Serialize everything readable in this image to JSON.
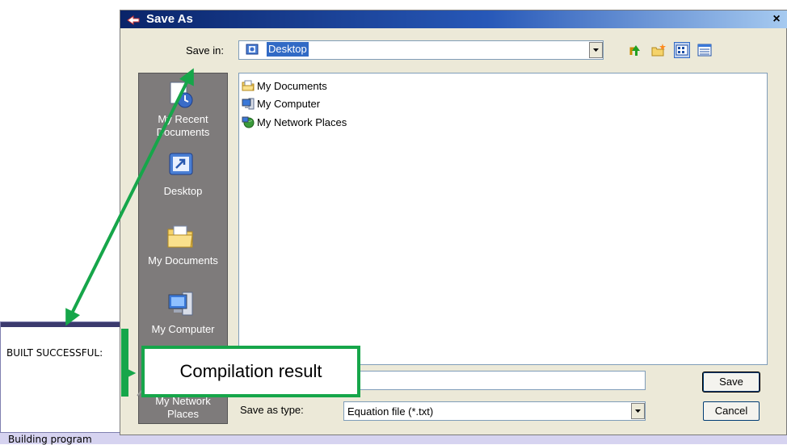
{
  "background_app": {
    "build_message": "BUILT SUCCESSFUL:",
    "status_text": "Building program"
  },
  "dialog": {
    "title": "Save As",
    "close_symbol": "×",
    "save_in_label": "Save in:",
    "save_in_value": "Desktop",
    "toolbar_icons": [
      "up-one-level-icon",
      "create-new-folder-icon",
      "view-menu-icon",
      "details-view-icon"
    ],
    "places": [
      {
        "label": "My Recent Documents",
        "icon": "recent-documents-icon"
      },
      {
        "label": "Desktop",
        "icon": "desktop-icon"
      },
      {
        "label": "My Documents",
        "icon": "my-documents-icon"
      },
      {
        "label": "My Computer",
        "icon": "my-computer-icon"
      },
      {
        "label": "My Network Places",
        "icon": "network-places-icon"
      }
    ],
    "files": [
      {
        "name": "My Documents",
        "icon": "folder-icon"
      },
      {
        "name": "My Computer",
        "icon": "computer-icon"
      },
      {
        "name": "My Network Places",
        "icon": "network-icon"
      }
    ],
    "file_name_value": "",
    "save_as_type_label": "Save as type:",
    "save_as_type_value": "Equation file (*.txt)",
    "save_button": "Save",
    "cancel_button": "Cancel"
  },
  "annotation": {
    "callout_text": "Compilation result",
    "arrow_color": "#16a64a"
  }
}
